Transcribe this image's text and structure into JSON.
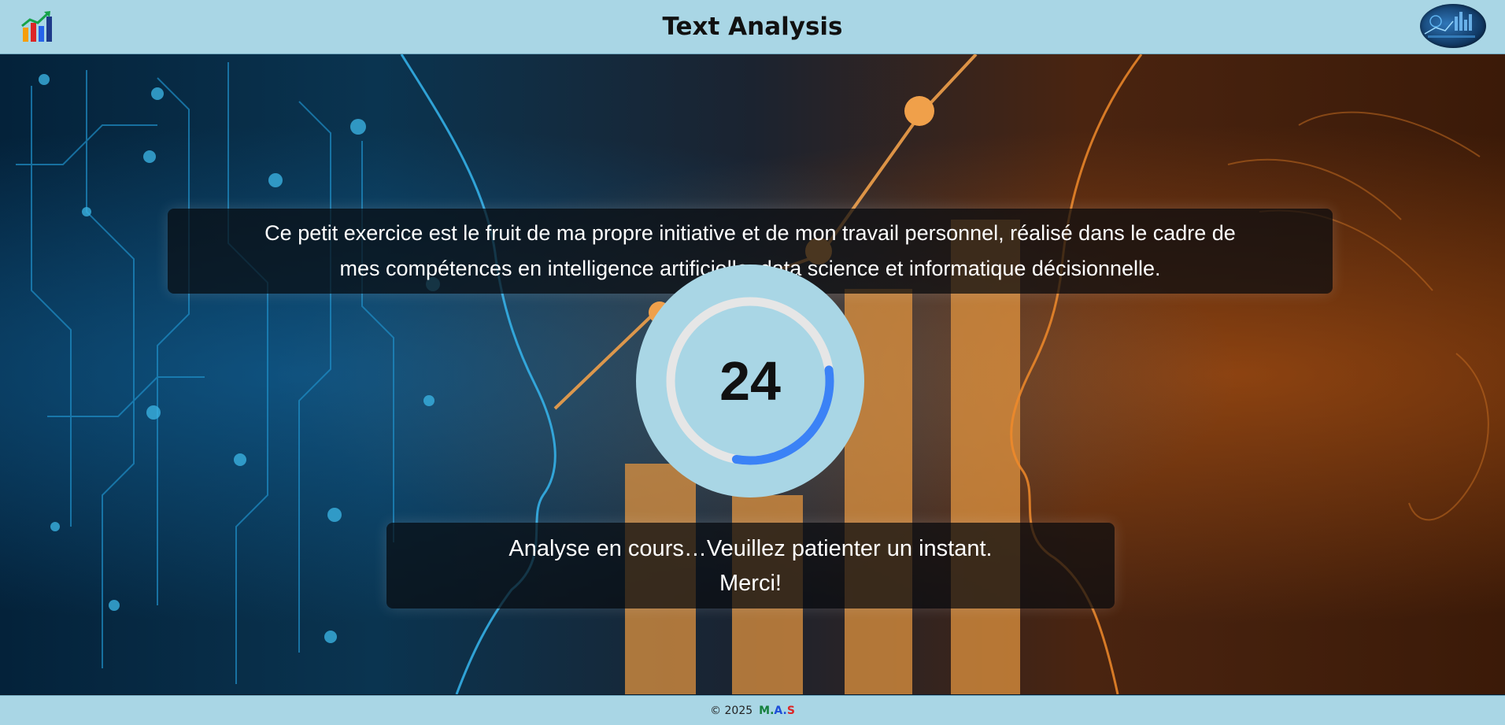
{
  "header": {
    "title": "Text Analysis",
    "logo_icon": "bar-chart-growth-icon",
    "badge_icon": "data-dashboard-thumbnail"
  },
  "message_top": {
    "line1": "Ce petit exercice est le fruit de ma propre initiative et de mon travail personnel, réalisé dans le cadre de",
    "line2": "mes compétences en intelligence artificielle, data science et informatique décisionnelle."
  },
  "spinner": {
    "count": "24",
    "progress": 0.3,
    "track_color": "#e6e6e6",
    "progress_color": "#3b82f6"
  },
  "message_bottom": {
    "line1": "Analyse en cours…Veuillez patienter un instant.",
    "line2": "Merci!"
  },
  "footer": {
    "copyright": "© 2025",
    "brand": [
      {
        "text": "M.",
        "color": "#15803d"
      },
      {
        "text": "A.",
        "color": "#1d4ed8"
      },
      {
        "text": "S",
        "color": "#dc2626"
      }
    ]
  }
}
